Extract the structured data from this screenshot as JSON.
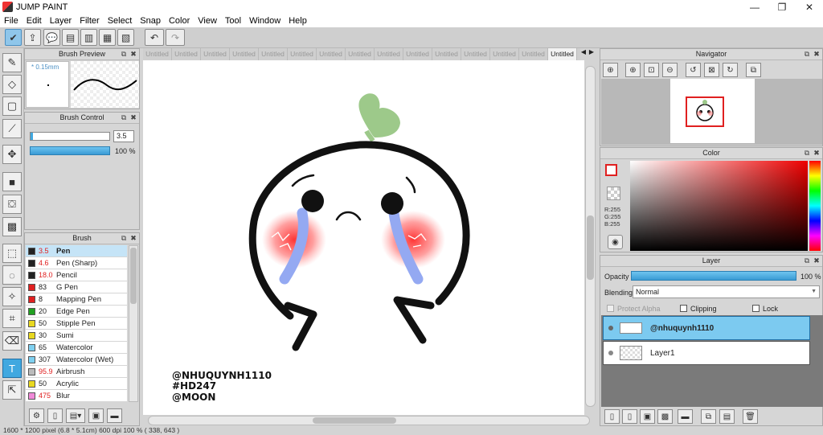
{
  "app": {
    "title": "JUMP PAINT"
  },
  "window_controls": {
    "minimize": "—",
    "maximize": "❐",
    "close": "✕"
  },
  "menu": [
    "File",
    "Edit",
    "Layer",
    "Filter",
    "Select",
    "Snap",
    "Color",
    "View",
    "Tool",
    "Window",
    "Help"
  ],
  "brush_preview": {
    "title": "Brush Preview",
    "size_label": "* 0.15mm"
  },
  "brush_control": {
    "title": "Brush Control",
    "size_value": "3.5",
    "opacity_value": "100 %"
  },
  "brush_panel": {
    "title": "Brush",
    "items": [
      {
        "size": "3.5",
        "name": "Pen",
        "color": "#222222",
        "size_color": "#e02020",
        "selected": true
      },
      {
        "size": "4.6",
        "name": "Pen (Sharp)",
        "color": "#222222",
        "size_color": "#e02020"
      },
      {
        "size": "18.0",
        "name": "Pencil",
        "color": "#222222",
        "size_color": "#e02020"
      },
      {
        "size": "83",
        "name": "G Pen",
        "color": "#e02020",
        "size_color": "#222222"
      },
      {
        "size": "8",
        "name": "Mapping Pen",
        "color": "#e02020",
        "size_color": "#222222"
      },
      {
        "size": "20",
        "name": "Edge Pen",
        "color": "#20a020",
        "size_color": "#222222"
      },
      {
        "size": "50",
        "name": "Stipple Pen",
        "color": "#e8d820",
        "size_color": "#222222"
      },
      {
        "size": "30",
        "name": "Sumi",
        "color": "#e8d820",
        "size_color": "#222222"
      },
      {
        "size": "65",
        "name": "Watercolor",
        "color": "#7fd0f0",
        "size_color": "#222222"
      },
      {
        "size": "307",
        "name": "Watercolor (Wet)",
        "color": "#7fd0f0",
        "size_color": "#222222"
      },
      {
        "size": "95.9",
        "name": "Airbrush",
        "color": "#bbbbbb",
        "size_color": "#e02020"
      },
      {
        "size": "50",
        "name": "Acrylic",
        "color": "#e8d820",
        "size_color": "#222222"
      },
      {
        "size": "475",
        "name": "Blur",
        "color": "#f08ad8",
        "size_color": "#e02020"
      }
    ]
  },
  "tabs": [
    "Untitled",
    "Untitled",
    "Untitled",
    "Untitled",
    "Untitled",
    "Untitled",
    "Untitled",
    "Untitled",
    "Untitled",
    "Untitled",
    "Untitled",
    "Untitled",
    "Untitled",
    "Untitled",
    "Untitled"
  ],
  "canvas_text": {
    "line1": "@NHUQUYNH1110",
    "line2": "#HD247",
    "line3": "@MOON"
  },
  "navigator": {
    "title": "Navigator"
  },
  "color_panel": {
    "title": "Color",
    "r": "R:255",
    "g": "G:255",
    "b": "B:255"
  },
  "layer_panel": {
    "title": "Layer",
    "opacity_label": "Opacity",
    "opacity_value": "100 %",
    "blending_label": "Blending",
    "blending_value": "Normal",
    "protect_alpha": "Protect Alpha",
    "clipping": "Clipping",
    "lock": "Lock",
    "layers": [
      {
        "name": "@nhuquynh1110",
        "selected": true
      },
      {
        "name": "Layer1",
        "selected": false
      }
    ]
  },
  "status": "1600 * 1200 pixel  (6.8 * 5.1cm)  600 dpi  100 %  ( 338, 643 )",
  "colors": {
    "accent": "#40a8e0",
    "selected_row": "#7ccaf0",
    "brush_selected": "#c5e4f7"
  }
}
